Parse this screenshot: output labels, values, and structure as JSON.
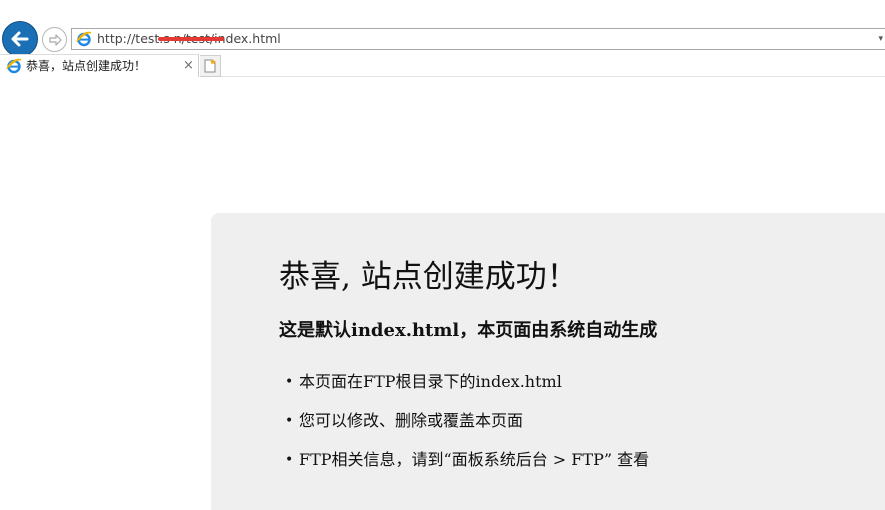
{
  "browser": {
    "address_url": "http://test.s           n/test/index.html",
    "dropdown_glyph": "▾",
    "tab_title": "恭喜，站点创建成功！",
    "tab_close": "×"
  },
  "page": {
    "heading": "恭喜, 站点创建成功！",
    "subheading": "这是默认index.html，本页面由系统自动生成",
    "list": [
      "本页面在FTP根目录下的index.html",
      "您可以修改、删除或覆盖本页面",
      "FTP相关信息，请到“面板系统后台 > FTP” 查看"
    ],
    "bullet": "•"
  },
  "icons": {
    "back": "back-arrow-icon",
    "forward": "forward-arrow-icon",
    "favicon": "ie-favicon-icon",
    "new_tab": "new-tab-icon",
    "accent": "#1a6fb5"
  }
}
